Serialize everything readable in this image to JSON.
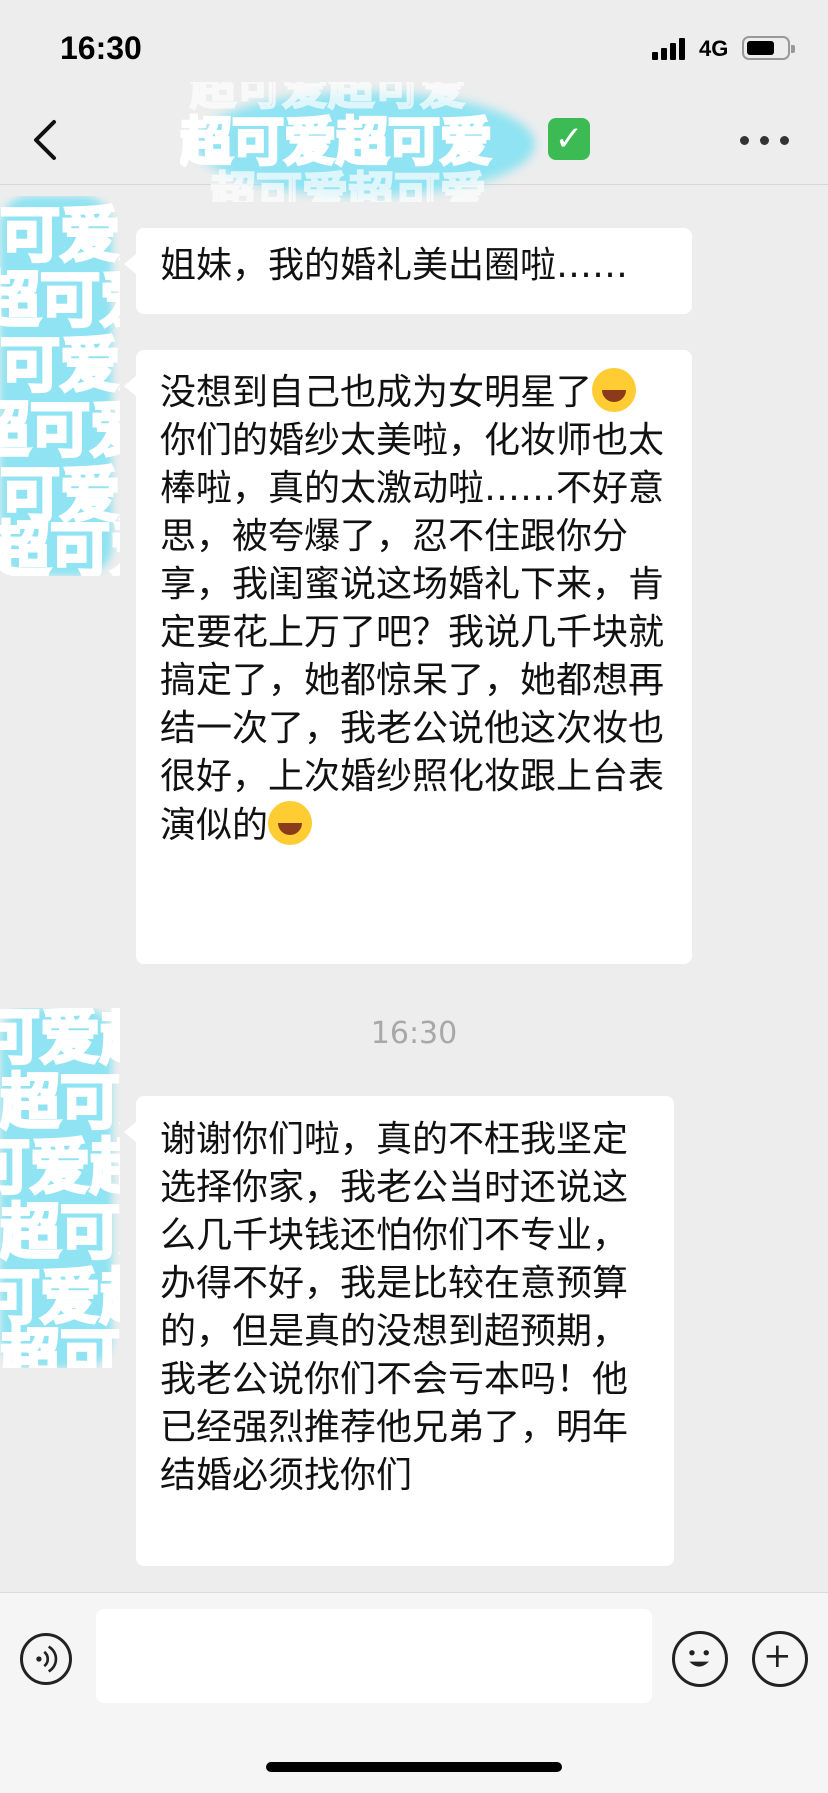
{
  "status": {
    "time": "16:30",
    "network": "4G"
  },
  "nav": {
    "title_art_text": "超可爱超可爱"
  },
  "avatar_art_text": "超可爱",
  "messages": [
    {
      "text": "姐妹，我的婚礼美出圈啦……"
    },
    {
      "text_parts": [
        "没想到自己也成为女明星了",
        "你们的婚纱太美啦，化妆师也太棒啦，真的太激动啦……不好意思，被夸爆了，忍不住跟你分享，我闺蜜说这场婚礼下来，肯定要花上万了吧？我说几千块就搞定了，她都惊呆了，她都想再结一次了，我老公说他这次妆也很好，上次婚纱照化妆跟上台表演似的"
      ]
    },
    {
      "timestamp": "16:30"
    },
    {
      "text": "谢谢你们啦，真的不枉我坚定选择你家，我老公当时还说这么几千块钱还怕你们不专业，办得不好，我是比较在意预算的，但是真的没想到超预期，我老公说你们不会亏本吗！他已经强烈推荐他兄弟了，明年结婚必须找你们"
    }
  ],
  "icons": [
    "back-chevron-icon",
    "check-mark-icon",
    "more-dots-icon",
    "voice-icon",
    "emoji-icon",
    "plus-icon",
    "laugh-cry-emoji-icon"
  ],
  "colors": {
    "background": "#ededed",
    "bubble": "#ffffff",
    "accent_pink": "#f06a9c",
    "accent_blue": "#8fe3f2",
    "check": "#3cba54"
  }
}
